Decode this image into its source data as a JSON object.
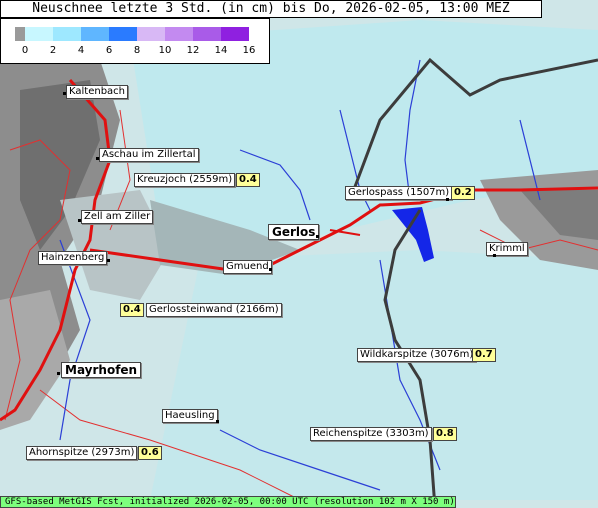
{
  "title": "Neuschnee letzte 3 Std. (in cm) bis Do, 2026-02-05, 13:00 MEZ",
  "legend": {
    "ticks": [
      "0",
      "2",
      "4",
      "6",
      "8",
      "10",
      "12",
      "14",
      "16"
    ],
    "colors": [
      "#9a9a9a",
      "#c8f7ff",
      "#9ee8ff",
      "#5fb6ff",
      "#2a7bff",
      "#d8b8f5",
      "#c38af0",
      "#a95be8",
      "#8f20e0"
    ]
  },
  "places": {
    "kaltenbach": "Kaltenbach",
    "aschau": "Aschau im Zillertal",
    "kreuzjoch": "Kreuzjoch (2559m)",
    "zell": "Zell am Ziller",
    "hainzenberg": "Hainzenberg",
    "gerlos": "Gerlos",
    "gmuend": "Gmuend",
    "gerlospass": "Gerlospass (1507m)",
    "krimml": "Krimml",
    "gerlossteinwand": "Gerlossteinwand (2166m)",
    "mayrhofen": "Mayrhofen",
    "wildkarspitze": "Wildkarspitze (3076m)",
    "haeusling": "Haeusling",
    "reichenspitze": "Reichenspitze (3303m)",
    "ahornspitze": "Ahornspitze (2973m)"
  },
  "values": {
    "kreuzjoch": "0.4",
    "gerlospass": "0.2",
    "gerlossteinwand": "0.4",
    "wildkarspitze": "0.7",
    "reichenspitze": "0.8",
    "ahornspitze": "0.6"
  },
  "footer": "GFS-based MetGIS Fcst, initialized 2026-02-05, 00:00 UTC  (resolution 102 m X 150 m)"
}
